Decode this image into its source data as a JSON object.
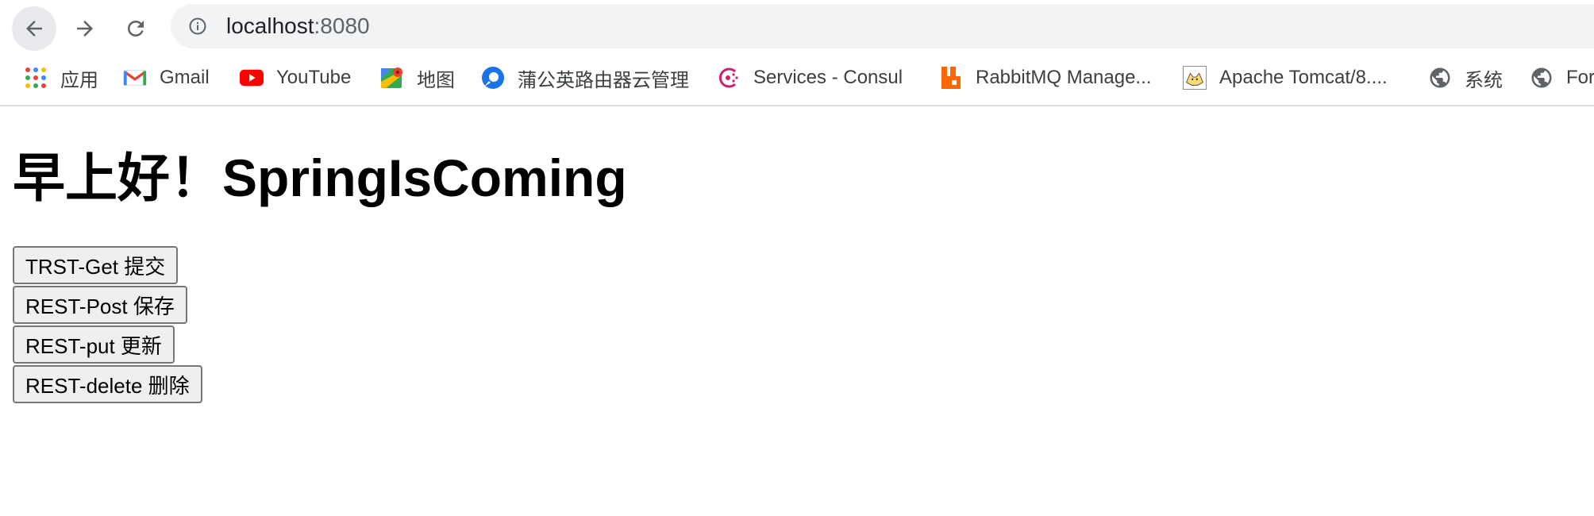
{
  "browser": {
    "url_host": "localhost",
    "url_port": ":8080",
    "icons": {
      "back": "back-arrow-icon",
      "forward": "forward-arrow-icon",
      "reload": "reload-icon",
      "info": "info-icon"
    }
  },
  "bookmarks": [
    {
      "label": "应用",
      "icon": "apps-grid-icon"
    },
    {
      "label": "Gmail",
      "icon": "gmail-icon"
    },
    {
      "label": "YouTube",
      "icon": "youtube-icon"
    },
    {
      "label": "地图",
      "icon": "maps-icon"
    },
    {
      "label": "蒲公英路由器云管理",
      "icon": "pgy-router-icon"
    },
    {
      "label": "Services - Consul",
      "icon": "consul-icon"
    },
    {
      "label": "RabbitMQ Manage...",
      "icon": "rabbitmq-icon"
    },
    {
      "label": "Apache Tomcat/8....",
      "icon": "tomcat-icon"
    },
    {
      "label": "系统",
      "icon": "globe-icon"
    },
    {
      "label": "For",
      "icon": "globe-icon"
    }
  ],
  "page": {
    "title": "早上好！SpringIsComing",
    "buttons": [
      {
        "label": "TRST-Get 提交"
      },
      {
        "label": "REST-Post 保存"
      },
      {
        "label": "REST-put 更新"
      },
      {
        "label": "REST-delete 删除"
      }
    ]
  },
  "colors": {
    "youtube": "#ff0000",
    "rabbitmq": "#ff6600",
    "consul": "#ca2171",
    "omnibox_bg": "#f1f3f4"
  }
}
